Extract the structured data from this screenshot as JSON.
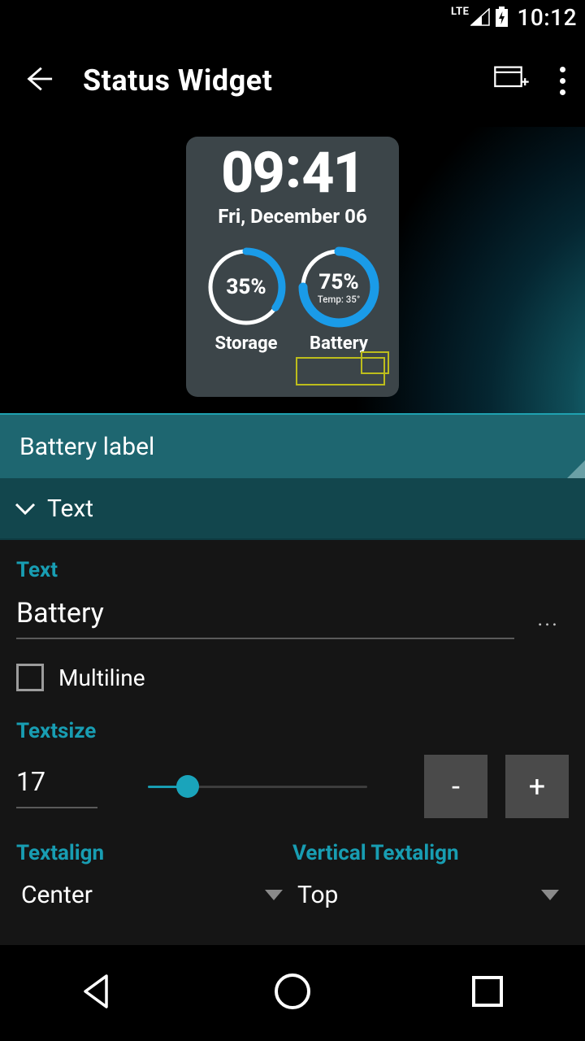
{
  "status_bar": {
    "network": "LTE",
    "time": "10:12"
  },
  "action_bar": {
    "title": "Status Widget"
  },
  "widget": {
    "time_h": "09",
    "time_m": "41",
    "date": "Fri, December 06",
    "gauge1": {
      "pct": "35%",
      "caption": "Storage",
      "value": 35
    },
    "gauge2": {
      "pct": "75%",
      "caption": "Battery",
      "value": 75,
      "sub": "Temp: 35°"
    }
  },
  "spinner": {
    "label": "Battery label"
  },
  "section": {
    "title": "Text"
  },
  "form": {
    "text_label": "Text",
    "text_value": "Battery",
    "multiline_label": "Multiline",
    "textsize_label": "Textsize",
    "textsize_value": "17",
    "minus": "-",
    "plus": "+",
    "textalign_label": "Textalign",
    "textalign_value": "Center",
    "valign_label": "Vertical Textalign",
    "valign_value": "Top"
  }
}
